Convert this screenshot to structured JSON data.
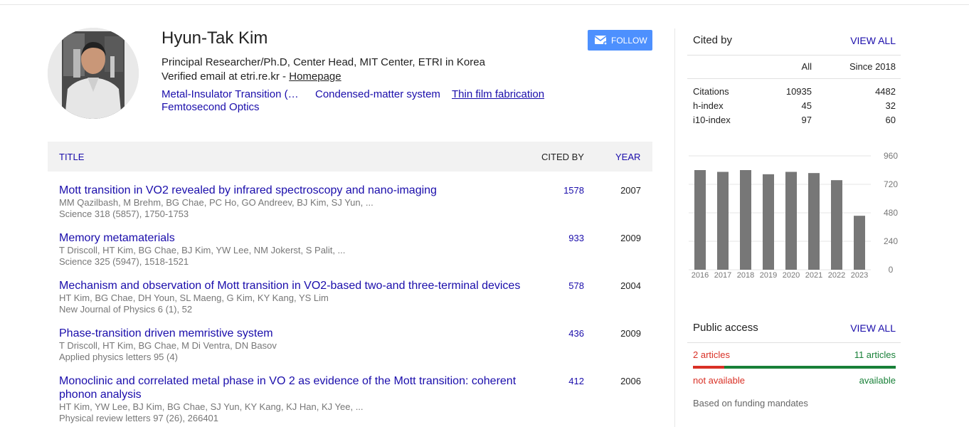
{
  "profile": {
    "name": "Hyun-Tak Kim",
    "affiliation": "Principal Researcher/Ph.D, Center Head, MIT Center, ETRI in Korea",
    "email_text": "Verified email at etri.re.kr - ",
    "homepage_label": "Homepage",
    "interests": [
      "Metal-Insulator Transition (…",
      "Condensed-matter system",
      "Thin film fabrication",
      "Femtosecond Optics"
    ],
    "follow_label": "FOLLOW"
  },
  "table": {
    "headers": {
      "title": "TITLE",
      "cited_by": "CITED BY",
      "year": "YEAR"
    },
    "rows": [
      {
        "title": "Mott transition in VO2 revealed by infrared spectroscopy and nano-imaging",
        "authors": "MM Qazilbash, M Brehm, BG Chae, PC Ho, GO Andreev, BJ Kim, SJ Yun, ...",
        "venue": "Science 318 (5857), 1750-1753",
        "cited": "1578",
        "year": "2007"
      },
      {
        "title": "Memory metamaterials",
        "authors": "T Driscoll, HT Kim, BG Chae, BJ Kim, YW Lee, NM Jokerst, S Palit, ...",
        "venue": "Science 325 (5947), 1518-1521",
        "cited": "933",
        "year": "2009"
      },
      {
        "title": "Mechanism and observation of Mott transition in VO2-based two-and three-terminal devices",
        "authors": "HT Kim, BG Chae, DH Youn, SL Maeng, G Kim, KY Kang, YS Lim",
        "venue": "New Journal of Physics 6 (1), 52",
        "cited": "578",
        "year": "2004"
      },
      {
        "title": "Phase-transition driven memristive system",
        "authors": "T Driscoll, HT Kim, BG Chae, M Di Ventra, DN Basov",
        "venue": "Applied physics letters 95 (4)",
        "cited": "436",
        "year": "2009"
      },
      {
        "title": "Monoclinic and correlated metal phase in VO 2 as evidence of the Mott transition: coherent phonon analysis",
        "authors": "HT Kim, YW Lee, BJ Kim, BG Chae, SJ Yun, KY Kang, KJ Han, KJ Yee, ...",
        "venue": "Physical review letters 97 (26), 266401",
        "cited": "412",
        "year": "2006"
      }
    ]
  },
  "cited_by": {
    "title": "Cited by",
    "view_all": "VIEW ALL",
    "col_all": "All",
    "col_since": "Since 2018",
    "stats": [
      {
        "label": "Citations",
        "all": "10935",
        "since": "4482"
      },
      {
        "label": "h-index",
        "all": "45",
        "since": "32"
      },
      {
        "label": "i10-index",
        "all": "97",
        "since": "60"
      }
    ]
  },
  "chart_data": {
    "type": "bar",
    "categories": [
      "2016",
      "2017",
      "2018",
      "2019",
      "2020",
      "2021",
      "2022",
      "2023"
    ],
    "values": [
      840,
      825,
      840,
      805,
      825,
      815,
      755,
      455
    ],
    "ylim": [
      0,
      960
    ],
    "yticks": [
      "960",
      "720",
      "480",
      "240",
      "0"
    ],
    "bar_color": "#777777"
  },
  "public_access": {
    "title": "Public access",
    "view_all": "VIEW ALL",
    "not_available_count": "2 articles",
    "available_count": "11 articles",
    "not_available_label": "not available",
    "available_label": "available",
    "note": "Based on funding mandates",
    "red_color": "#d93025",
    "green_color": "#188038",
    "not_available_value": 2,
    "available_value": 11
  }
}
